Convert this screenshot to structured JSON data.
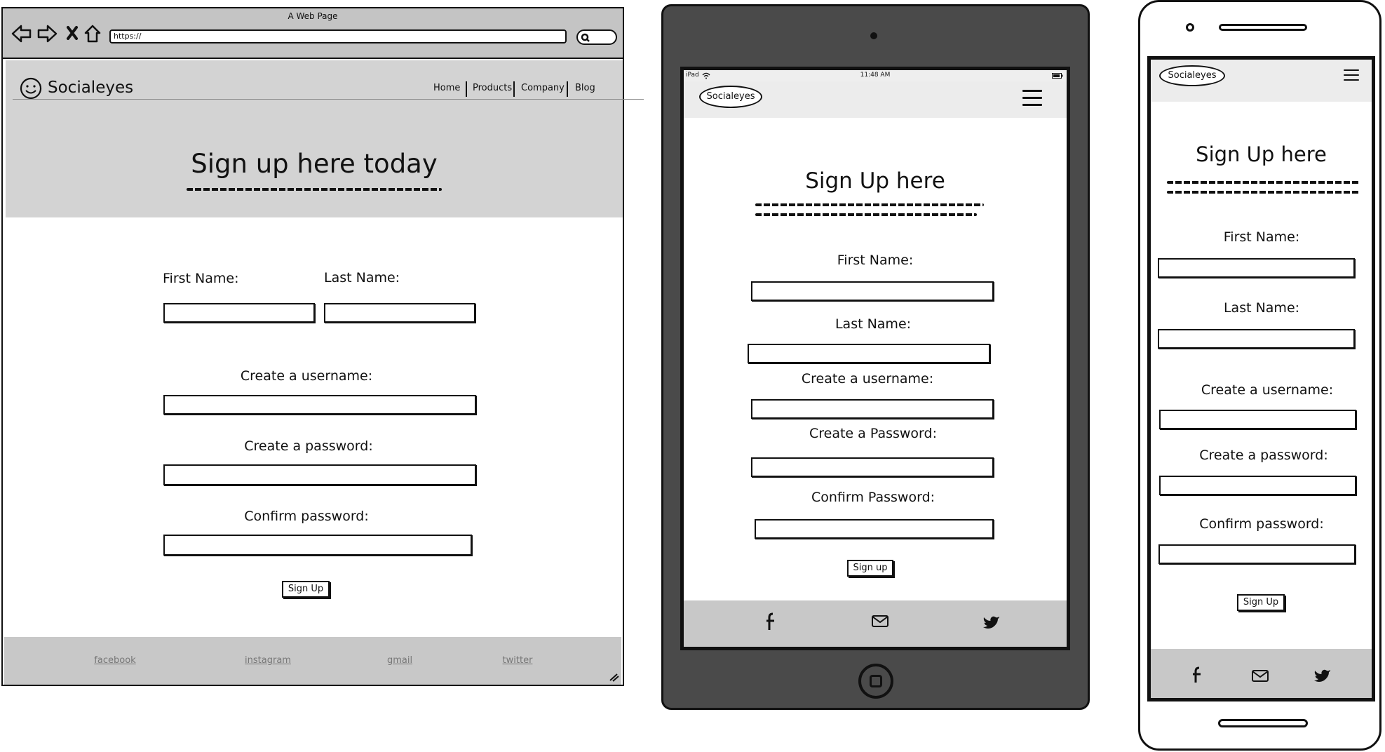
{
  "desktop": {
    "window_title": "A Web Page",
    "url": "https://",
    "brand": "Socialeyes",
    "nav": [
      "Home",
      "Products",
      "Company",
      "Blog"
    ],
    "hero_title": "Sign up here today",
    "first_name_label": "First Name:",
    "last_name_label": "Last Name:",
    "username_label": "Create a username:",
    "password_label": "Create a password:",
    "confirm_label": "Confirm password:",
    "submit_label": "Sign Up",
    "footer_links": [
      "facebook",
      "instagram",
      "gmail",
      "twitter"
    ]
  },
  "tablet": {
    "status_device": "iPad",
    "status_time": "11:48 AM",
    "brand": "Socialeyes",
    "title": "Sign Up here",
    "first_name_label": "First Name:",
    "last_name_label": "Last Name:",
    "username_label": "Create a username:",
    "password_label": "Create a Password:",
    "confirm_label": "Confirm Password:",
    "submit_label": "Sign up"
  },
  "phone": {
    "brand": "Socialeyes",
    "title": "Sign Up here",
    "first_name_label": "First Name:",
    "last_name_label": "Last Name:",
    "username_label": "Create a username:",
    "password_label": "Create a password:",
    "confirm_label": "Confirm password:",
    "submit_label": "Sign Up"
  },
  "icons": {
    "facebook": "facebook-icon",
    "mail": "mail-icon",
    "twitter": "twitter-icon",
    "back": "back-arrow-icon",
    "forward": "forward-arrow-icon",
    "stop": "close-icon",
    "home": "home-icon",
    "search": "search-icon",
    "smiley": "smiley-logo-icon",
    "menu": "hamburger-menu-icon"
  },
  "colors": {
    "panel_gray": "#d3d3d3",
    "chrome_gray": "#c4c4c4",
    "tablet_body": "#4a4a4a",
    "ink": "#111111"
  }
}
